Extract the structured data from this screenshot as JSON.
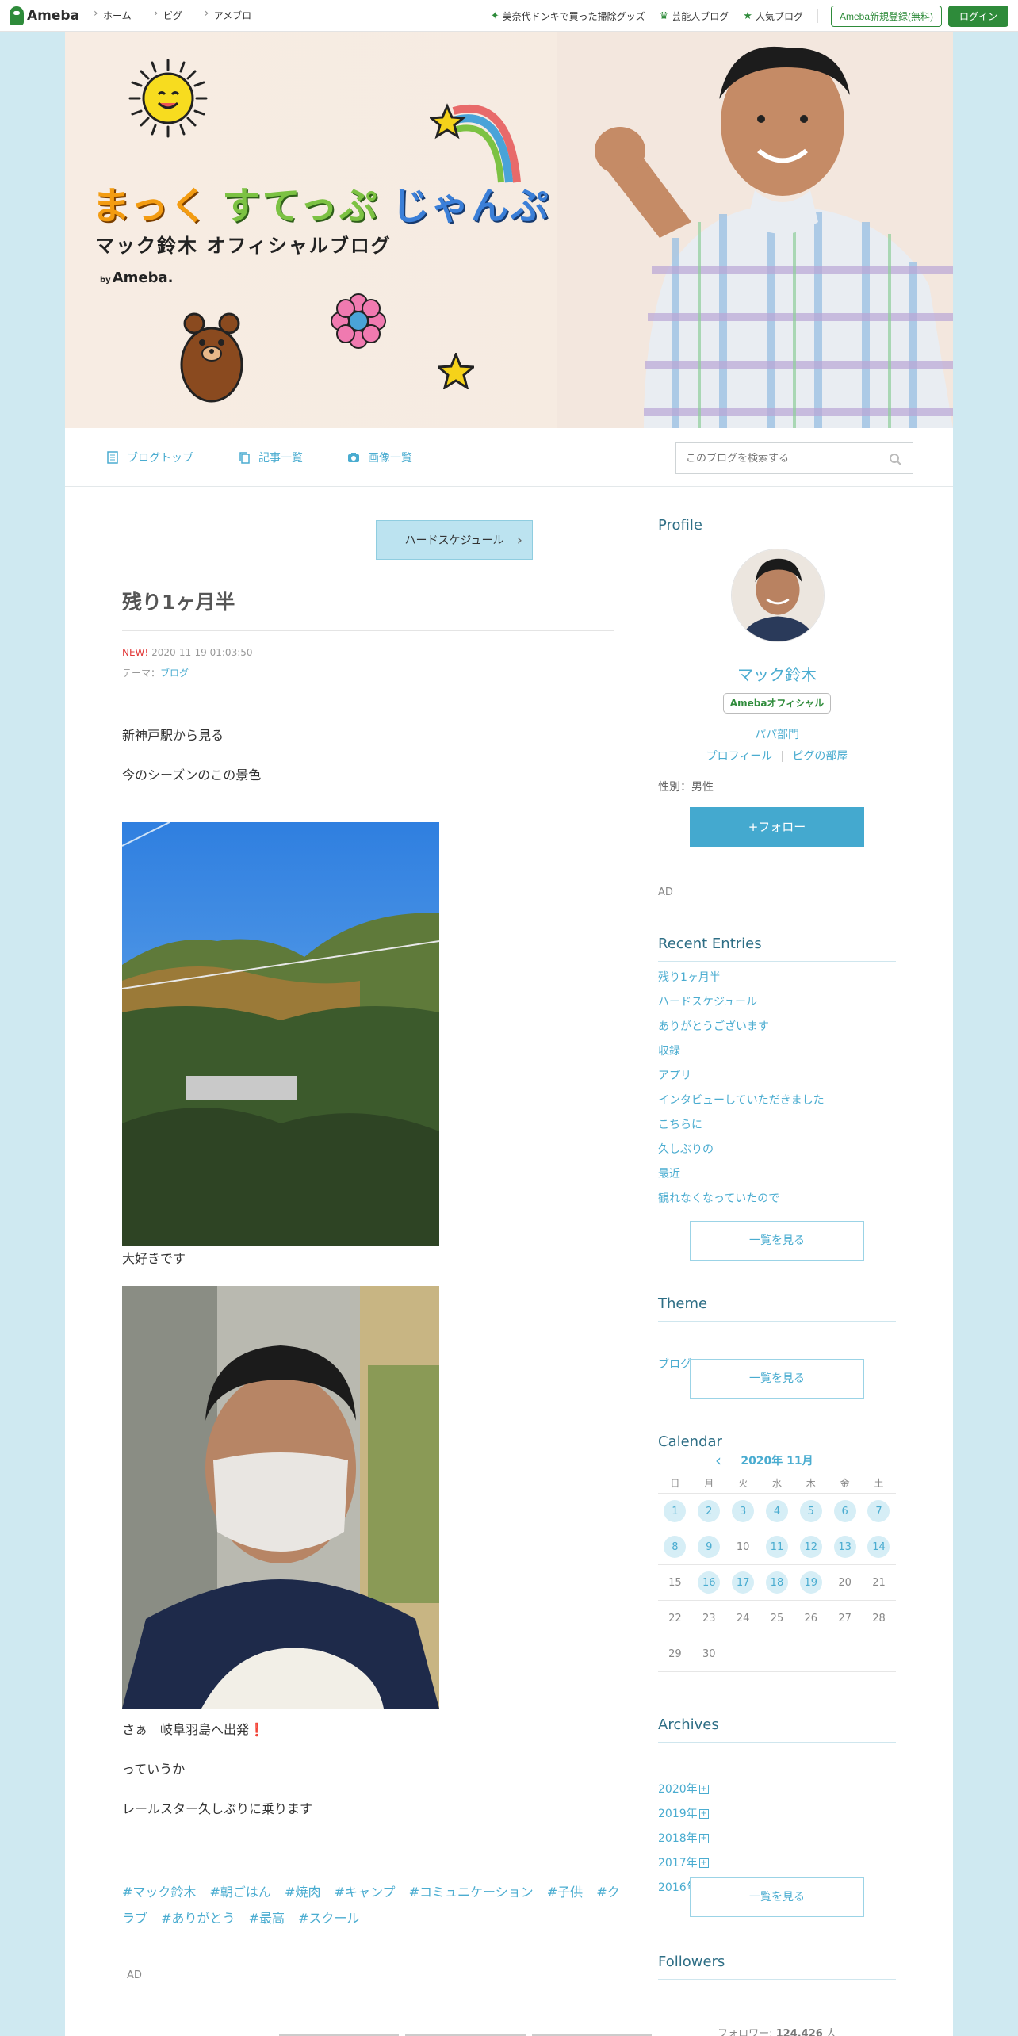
{
  "topbar": {
    "logo": "Ameba",
    "nav": [
      "ホーム",
      "ピグ",
      "アメブロ"
    ],
    "links": [
      "美奈代ドンキで買った掃除グッズ",
      "芸能人ブログ",
      "人気ブログ"
    ],
    "register": "Ameba新規登録(無料)",
    "login": "ログイン"
  },
  "banner": {
    "title_part1": "まっく",
    "title_part2": "すてっぷ",
    "title_part3": "じゃんぷ",
    "subtitle": "マック鈴木 オフィシャルブログ",
    "by": "by",
    "brand": "Ameba."
  },
  "blognav": {
    "items": [
      "ブログトップ",
      "記事一覧",
      "画像一覧"
    ],
    "search_placeholder": "このブログを検索する"
  },
  "article": {
    "prev_next": "ハードスケジュール",
    "title": "残り1ヶ月半",
    "new_label": "NEW!",
    "date": "2020-11-19 01:03:50",
    "theme_label": "テーマ：",
    "theme": "ブログ",
    "p1": "新神戸駅から見る",
    "p2": "今のシーズンのこの景色",
    "p3": "大好きです",
    "p4": "さぁ　岐阜羽島へ出発❗️",
    "p5": "っていうか",
    "p6": "レールスター久しぶりに乗ります",
    "tags": [
      "#マック鈴木",
      "#朝ごはん",
      "#焼肉",
      "#キャンプ",
      "#コミュニケーション",
      "#子供",
      "#クラブ",
      "#ありがとう",
      "#最高",
      "#スクール"
    ],
    "ad": "AD"
  },
  "sidebar": {
    "profile_heading": "Profile",
    "name": "マック鈴木",
    "badge": "Amebaオフィシャル",
    "category": "パパ部門",
    "link_profile": "プロフィール",
    "link_room": "ピグの部屋",
    "gender": "性別：男性",
    "follow": "+フォロー",
    "ad": "AD",
    "recent_heading": "Recent Entries",
    "recent": [
      "残り1ヶ月半",
      "ハードスケジュール",
      "ありがとうございます",
      "収録",
      "アプリ",
      "インタビューしていただきました",
      "こちらに",
      "久しぶりの",
      "最近",
      "観れなくなっていたので"
    ],
    "more": "一覧を見る",
    "theme_heading": "Theme",
    "theme_item": "ブログ ( 4599 )",
    "calendar_heading": "Calendar",
    "calendar_month": "2020年 11月",
    "weekdays": [
      "日",
      "月",
      "火",
      "水",
      "木",
      "金",
      "土"
    ],
    "weeks": [
      [
        [
          "1",
          1
        ],
        [
          "2",
          1
        ],
        [
          "3",
          1
        ],
        [
          "4",
          1
        ],
        [
          "5",
          1
        ],
        [
          "6",
          1
        ],
        [
          "7",
          1
        ]
      ],
      [
        [
          "8",
          1
        ],
        [
          "9",
          1
        ],
        [
          "10",
          0
        ],
        [
          "11",
          1
        ],
        [
          "12",
          1
        ],
        [
          "13",
          1
        ],
        [
          "14",
          1
        ]
      ],
      [
        [
          "15",
          0
        ],
        [
          "16",
          1
        ],
        [
          "17",
          1
        ],
        [
          "18",
          1
        ],
        [
          "19",
          1
        ],
        [
          "20",
          0
        ],
        [
          "21",
          0
        ]
      ],
      [
        [
          "22",
          0
        ],
        [
          "23",
          0
        ],
        [
          "24",
          0
        ],
        [
          "25",
          0
        ],
        [
          "26",
          0
        ],
        [
          "27",
          0
        ],
        [
          "28",
          0
        ]
      ],
      [
        [
          "29",
          0
        ],
        [
          "30",
          0
        ],
        [
          "",
          0
        ],
        [
          "",
          0
        ],
        [
          "",
          0
        ],
        [
          "",
          0
        ],
        [
          "",
          0
        ]
      ]
    ],
    "archives_heading": "Archives",
    "archives": [
      "2020年",
      "2019年",
      "2018年",
      "2017年",
      "2016年"
    ],
    "followers_heading": "Followers",
    "followers_label": "フォロワー: ",
    "followers_count": "124,426",
    "followers_unit": " 人"
  },
  "colors": {
    "accent": "#4aacd0",
    "ameba_green": "#2e8b3a",
    "page_bg": "#cfe9f1"
  }
}
